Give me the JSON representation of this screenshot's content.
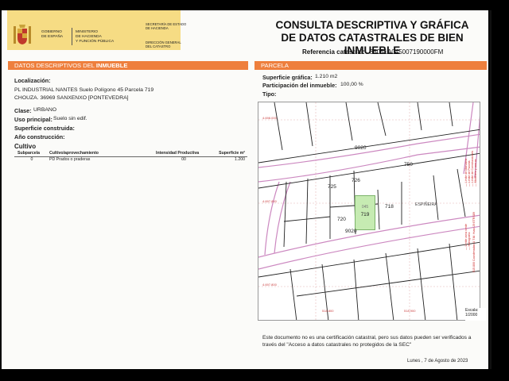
{
  "header": {
    "gov_name": [
      "GOBIERNO",
      "DE ESPAÑA"
    ],
    "ministry": [
      "MINISTERIO",
      "DE HACIENDA",
      "Y FUNCIÓN PÚBLICA"
    ],
    "secretaria": [
      "SECRETARÍA DE ESTADO",
      "DE HACIENDA"
    ],
    "direccion": [
      "DIRECCIÓN GENERAL",
      "DEL CATASTRO"
    ],
    "title_line1": "CONSULTA DESCRIPTIVA Y GRÁFICA",
    "title_line2": "DE DATOS CATASTRALES DE BIEN INMUEBLE",
    "ref_label": "Referencia catastral:",
    "ref_value": "36051A045007190000FM"
  },
  "left": {
    "bar_prefix": "DATOS DESCRIPTIVOS DEL ",
    "bar_bold": "INMUEBLE",
    "localizacion_label": "Localización:",
    "localizacion_line1": "PL INDUSTRIAL NANTES  Suelo Polígono 45 Parcela 719",
    "localizacion_line2": "CHOUZA. 36969 SANXENXO [PONTEVEDRA]",
    "clase_label": "Clase:",
    "clase_value": "URBANO",
    "uso_label": "Uso principal:",
    "uso_value": "Suelo sin edif.",
    "superficie_label": "Superficie construida:",
    "anio_label": "Año construcción:",
    "cultivo_title": "Cultivo",
    "table": {
      "headers": [
        "Subparcela",
        "Cultivo/aprovechamiento",
        "Intensidad Productiva",
        "Superficie m²"
      ],
      "rows": [
        [
          "0",
          "PD Prados o praderas",
          "00",
          "1.200"
        ]
      ]
    }
  },
  "right": {
    "bar_title": "PARCELA",
    "sup_grafica_label": "Superficie gráfica:",
    "sup_grafica_value": "1.210 m2",
    "participacion_label": "Participación del inmueble:",
    "participacion_value": "100,00 %",
    "tipo_label": "Tipo:"
  },
  "map": {
    "parcels": [
      "9020",
      "750",
      "726",
      "725",
      "719",
      "718",
      "720",
      "9020"
    ],
    "highlight_top": "045",
    "highlight_label": "719",
    "street": "ESPIÑEIRA",
    "coords": [
      "4.698.000",
      "4.697.850",
      "4.697.800",
      "518.800",
      "518.900"
    ],
    "legend_items": [
      "— Límite de Manzana",
      "— Límite de Parcela",
      "— Límite de Construcciones",
      "— Mobiliario y aceras",
      "— Límite zona verde",
      "— Hidrografía"
    ],
    "legend_coord": "515.800 Coordenadas U.T.M. Huso 29 ETRS89",
    "scale_label": "Escala:",
    "scale_value": "1/2000"
  },
  "footer": {
    "note": "Este documento no es una certificación catastral, pero sus datos pueden ser verificados a través del \"Acceso a datos catastrales no protegidos de la SEC\"",
    "date": "Lunes , 7 de Agosto de 2023"
  },
  "colors": {
    "accent": "#ee7f3d",
    "logo_bg": "#f6dc84",
    "highlight": "#c6ebb2",
    "road": "#cc88c0"
  }
}
